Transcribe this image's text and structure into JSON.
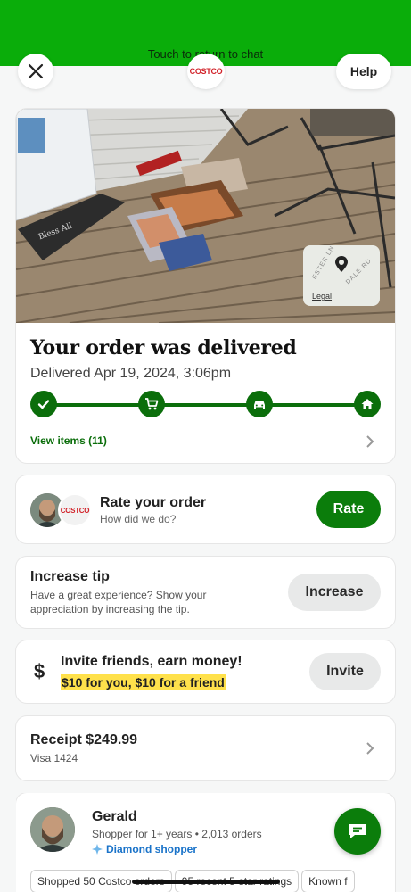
{
  "banner": {
    "text": "Touch to return to chat"
  },
  "header": {
    "help_label": "Help",
    "logo_text": "COSTCO"
  },
  "delivery": {
    "map_legal": "Legal",
    "map_street_1": "ESTER LN",
    "map_street_2": "DALE RD",
    "title": "Your order was delivered",
    "subtitle": "Delivered Apr 19, 2024, 3:06pm",
    "view_items": "View items (11)",
    "steps": [
      "check-icon",
      "cart-icon",
      "car-icon",
      "home-icon"
    ]
  },
  "rate": {
    "title": "Rate your order",
    "subtitle": "How did we do?",
    "button": "Rate"
  },
  "tip": {
    "title": "Increase tip",
    "subtitle": "Have a great experience? Show your appreciation by increasing the tip.",
    "button": "Increase"
  },
  "invite": {
    "title": "Invite friends, earn money!",
    "promo": "$10 for you, $10 for a friend",
    "button": "Invite",
    "icon_glyph": "$"
  },
  "receipt": {
    "title": "Receipt $249.99",
    "subtitle": "Visa 1424"
  },
  "shopper": {
    "name": "Gerald",
    "meta": "Shopper for 1+ years • 2,013 orders",
    "badge": "Diamond shopper",
    "chips": [
      "Shopped 50 Costco orders",
      "95 recent 5-star ratings",
      "Known f"
    ]
  },
  "colors": {
    "brand_green": "#0b7d0b",
    "banner_green": "#0aad0a",
    "promo_highlight": "#ffe14b",
    "badge_blue": "#1a73c9"
  }
}
